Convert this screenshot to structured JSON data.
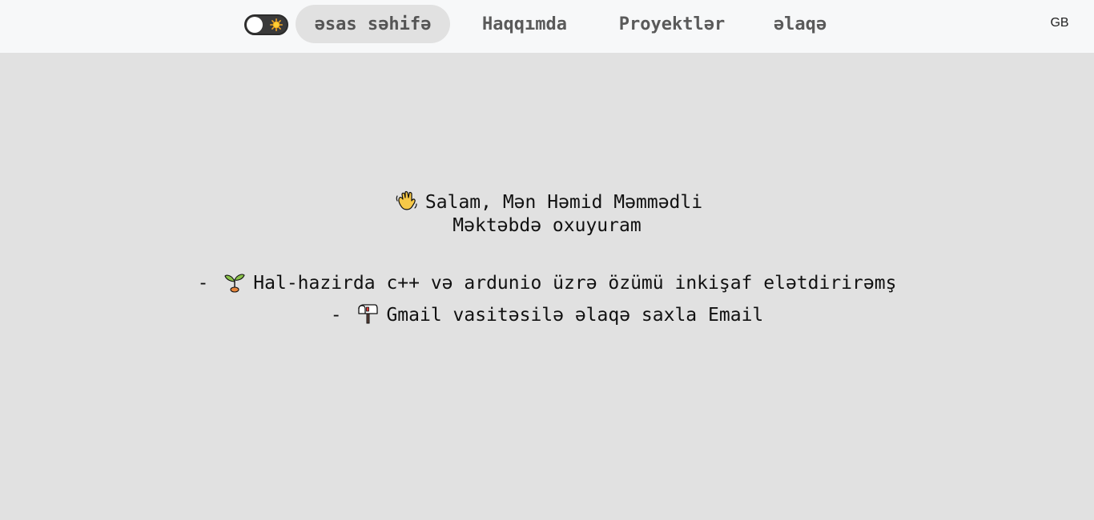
{
  "nav": {
    "items": [
      {
        "label": "əsas səhifə",
        "active": true
      },
      {
        "label": "Haqqımda",
        "active": false
      },
      {
        "label": "Proyektlər",
        "active": false
      },
      {
        "label": "əlaqə",
        "active": false
      }
    ],
    "theme_toggle_icon": "sun-icon",
    "language": "GB"
  },
  "intro": {
    "greeting": "Salam, Mən Həmid Məmmədli",
    "greeting_icon": "waving-hand-icon",
    "subtitle": "Məktəbdə oxuyuram"
  },
  "bullets": [
    {
      "prefix": "-",
      "icon": "seedling-icon",
      "text": "Hal-hazirda c++ və ardunio üzrə özümü inkişaf elətdirirəmş"
    },
    {
      "prefix": "-",
      "icon": "mailbox-icon",
      "text": "Gmail vasitəsilə əlaqə saxla",
      "link": "Email"
    }
  ],
  "colors": {
    "page_bg": "#e1e1e1",
    "nav_bg": "#f7f8f9",
    "active_pill": "#e1e1e1",
    "nav_text": "#5a5a5a"
  }
}
